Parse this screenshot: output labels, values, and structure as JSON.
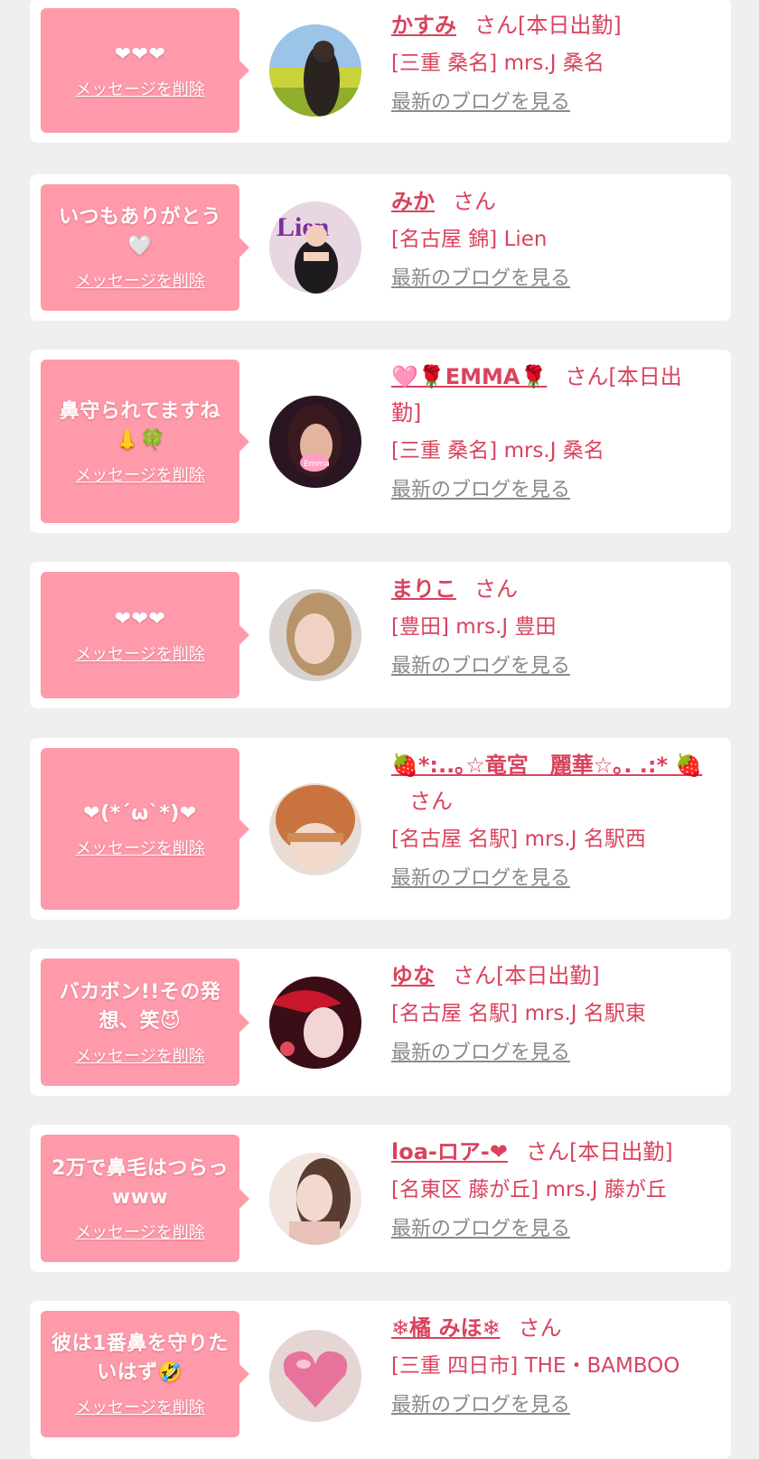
{
  "delete_label": "メッセージを削除",
  "blog_label": "最新のブログを見る",
  "colors": {
    "bubble": "#ff9aaa",
    "name": "#d9435e",
    "link_gray": "#8a8a8a",
    "page_bg": "#efefef"
  },
  "cards": [
    {
      "message": "❤❤❤",
      "name": "かすみ",
      "suffix": "さん[本日出勤]",
      "shop": "[三重 桑名] mrs.J 桑名",
      "avatar": "photo-woman-field"
    },
    {
      "message": "いつもありがとう\n🤍",
      "name": "みか",
      "suffix": "さん",
      "shop": "[名古屋 錦] Lien",
      "avatar": "photo-woman-lien"
    },
    {
      "message": "鼻守られてますね\n👃🍀",
      "name": "🩷🌹EMMA🌹",
      "suffix": "さん[本日出勤]",
      "shop": "[三重 桑名] mrs.J 桑名",
      "avatar": "photo-woman-emma"
    },
    {
      "message": "❤❤❤",
      "name": "まりこ",
      "suffix": "さん",
      "shop": "[豊田] mrs.J 豊田",
      "avatar": "photo-woman-blonde"
    },
    {
      "message": "❤(*´ω`*)❤",
      "name": "🍓*:..｡☆竜宮　麗華☆｡. .:* 🍓",
      "suffix": "さん",
      "shop": "[名古屋 名駅] mrs.J 名駅西",
      "avatar": "photo-woman-orange-hair"
    },
    {
      "message": "バカボン!!その発\n想、笑😈",
      "name": "ゆな",
      "suffix": "さん[本日出勤]",
      "shop": "[名古屋 名駅] mrs.J 名駅東",
      "avatar": "photo-woman-umbrella"
    },
    {
      "message": "2万で鼻毛はつらっ\nwww",
      "name": "loa-ロア-❤",
      "suffix": "さん[本日出勤]",
      "shop": "[名東区 藤が丘] mrs.J 藤が丘",
      "avatar": "photo-woman-loa"
    },
    {
      "message": "彼は1番鼻を守りた\nいはず🤣",
      "name": "❄橘 みほ❄",
      "suffix": "さん",
      "shop": "[三重 四日市] THE・BAMBOO",
      "avatar": "photo-heart-balloon"
    }
  ]
}
